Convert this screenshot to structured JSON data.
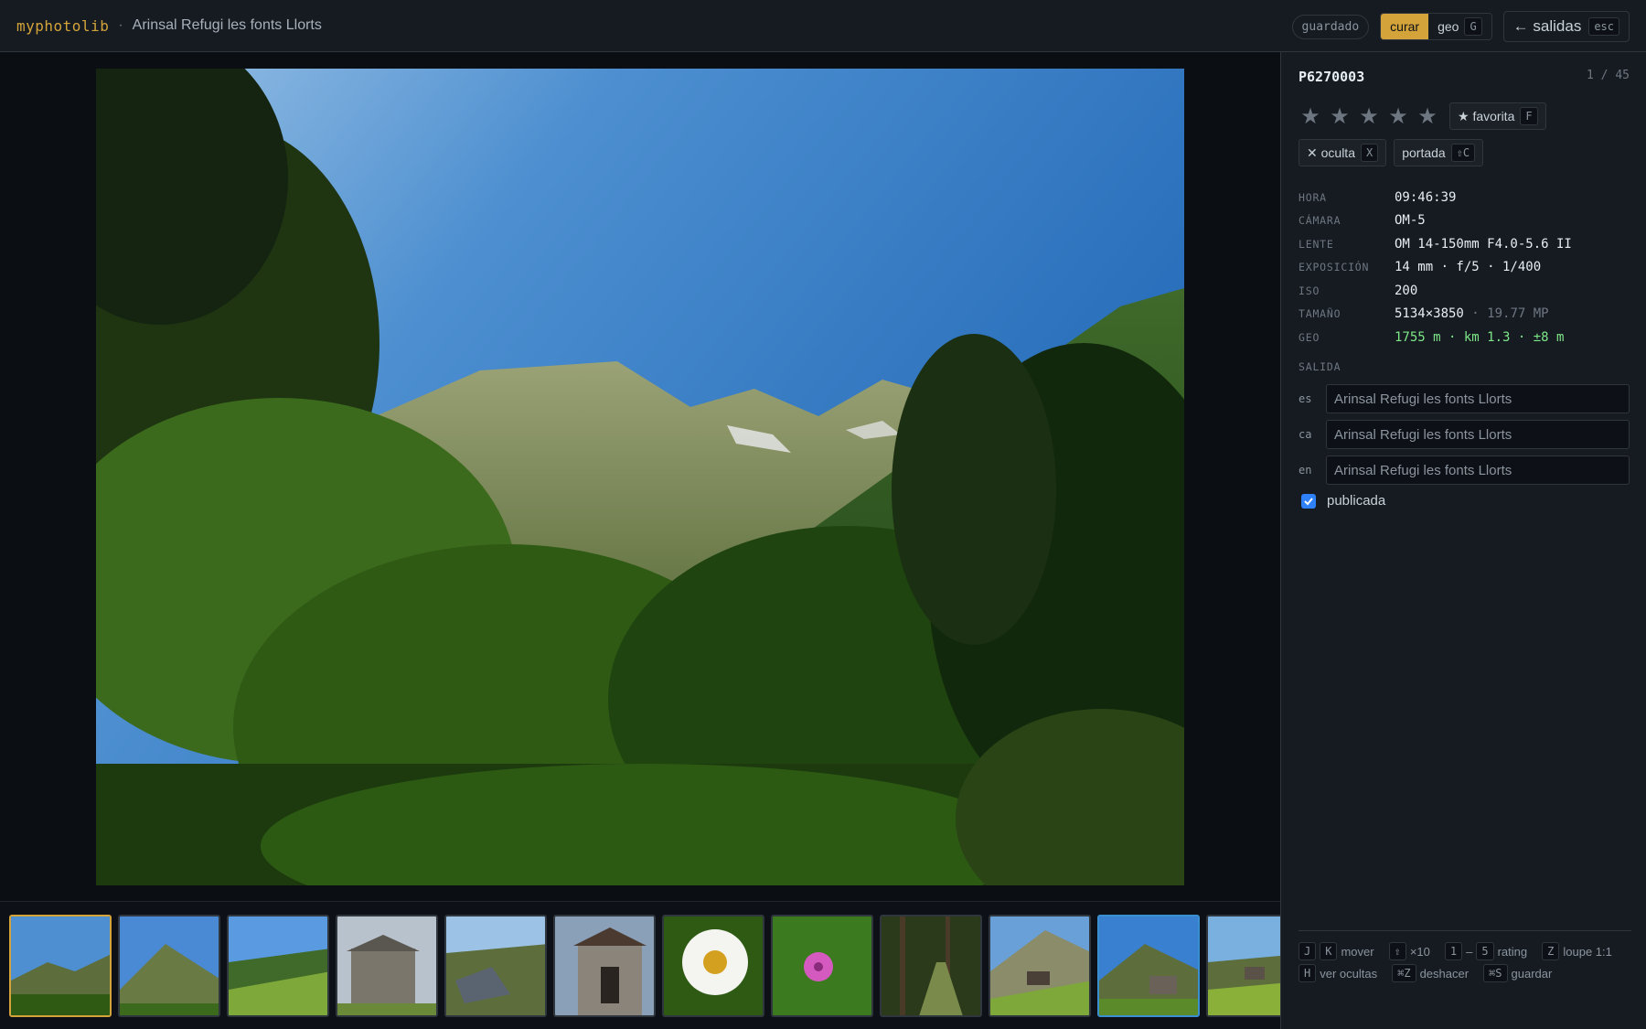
{
  "header": {
    "brand": "myphotolib",
    "separator": "·",
    "title": "Arinsal Refugi les fonts Llorts",
    "saved_label": "guardado",
    "mode_curar": "curar",
    "mode_geo": "geo",
    "mode_geo_key": "G",
    "back_label": "← salidas",
    "back_key": "esc"
  },
  "photo": {
    "id": "P6270003",
    "position": "1 / 45",
    "rating": 0,
    "rating_max": 5,
    "favorite_label": "★ favorita",
    "favorite_key": "F",
    "hide_label": "✕ oculta",
    "hide_key": "X",
    "cover_label": "portada",
    "cover_key": "⇧C"
  },
  "metadata": [
    {
      "key": "HORA",
      "value": "09:46:39"
    },
    {
      "key": "CÁMARA",
      "value": "OM-5"
    },
    {
      "key": "LENTE",
      "value": "OM 14-150mm F4.0-5.6 II"
    },
    {
      "key": "EXPOSICIÓN",
      "value": "14 mm · f/5 · 1/400"
    },
    {
      "key": "ISO",
      "value": "200"
    },
    {
      "key": "TAMAÑO",
      "value": "5134×3850",
      "extra": "· 19.77 MP"
    },
    {
      "key": "GEO",
      "value": "1755 m · km 1.3 · ±8 m"
    }
  ],
  "salida": {
    "label": "SALIDA",
    "names": [
      {
        "lang": "es",
        "value": "Arinsal Refugi les fonts Llorts"
      },
      {
        "lang": "ca",
        "value": "Arinsal Refugi les fonts Llorts"
      },
      {
        "lang": "en",
        "value": "Arinsal Refugi les fonts Llorts"
      }
    ],
    "published_label": "publicada",
    "published": true
  },
  "shortcuts": {
    "line1": [
      {
        "keys": [
          "J",
          "K"
        ],
        "label": "mover"
      },
      {
        "keys": [
          "⇧"
        ],
        "label": "×10"
      },
      {
        "keys": [
          "1",
          "5"
        ],
        "joiner": "–",
        "label": "rating"
      },
      {
        "keys": [
          "Z"
        ],
        "label": "loupe 1:1"
      }
    ],
    "line2": [
      {
        "keys": [
          "H"
        ],
        "label": "ver ocultas"
      },
      {
        "keys": [
          "⌘Z"
        ],
        "label": "deshacer"
      },
      {
        "keys": [
          "⌘S"
        ],
        "label": "guardar"
      }
    ]
  },
  "filmstrip": {
    "thumbs": [
      "valley",
      "mountain",
      "meadow",
      "stone-hut",
      "roof",
      "stone-door",
      "daisy",
      "pink-flower",
      "forest-path",
      "slope-hut",
      "valley-hut",
      "meadow-huts"
    ],
    "current_index": 0,
    "selected_index": 10
  },
  "colors": {
    "accent": "#d4a43a",
    "geo_green": "#7ee787",
    "selection_blue": "#3a8fd0"
  }
}
